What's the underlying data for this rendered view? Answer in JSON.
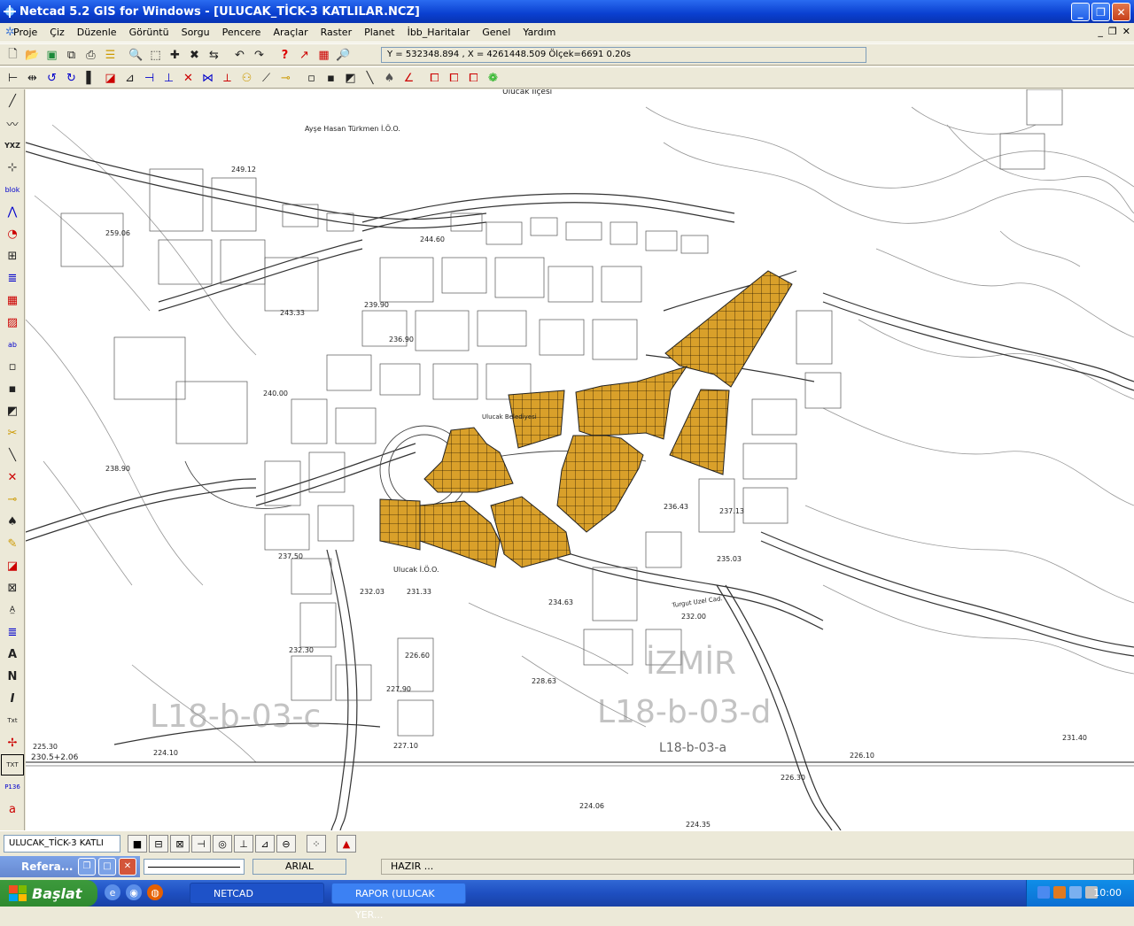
{
  "window": {
    "title": "Netcad 5.2 GIS for Windows - [ULUCAK_TİCK-3  KATLILAR.NCZ]"
  },
  "menu": [
    "Proje",
    "Çiz",
    "Düzenle",
    "Görüntü",
    "Sorgu",
    "Pencere",
    "Araçlar",
    "Raster",
    "Planet",
    "İbb_Haritalar",
    "Genel",
    "Yardım"
  ],
  "toolbar": {
    "coords": "Y = 532348.894 , X = 4261448.509  Ölçek=6691   0.20s"
  },
  "map": {
    "labels": [
      "Ulucak İlçesi",
      "Ayşe Hasan Türkmen İ.Ö.O.",
      "Ulucak Belediyesi",
      "Ulucak İ.Ö.O.",
      "Turgut Uzel Cad.",
      "İZMİR",
      "L18-b-03-d",
      "L18-b-03-a",
      "L18-b-03-c"
    ],
    "elevations": [
      "249.12",
      "259.06",
      "244.60",
      "243.33",
      "239.90",
      "236.90",
      "240.00",
      "238.90",
      "237.50",
      "232.03",
      "231.33",
      "236.43",
      "237.13",
      "235.03",
      "232.00",
      "234.63",
      "232.30",
      "226.60",
      "227.90",
      "228.63",
      "227.10",
      "226.10",
      "231.40",
      "224.10",
      "225.30",
      "224.06",
      "224.35",
      "226.30",
      "230.5+2.06"
    ],
    "fill_color": "#d9a02a"
  },
  "bottom": {
    "layer": "ULUCAK_TİCK-3  KATLI"
  },
  "status": {
    "ref_window": "Refera...",
    "font": "ARIAL",
    "message": "HAZIR ..."
  },
  "taskbar": {
    "start": "Başlat",
    "tasks": [
      "NETCAD",
      "RAPOR (ULUCAK YER..."
    ],
    "clock": "10:00"
  }
}
